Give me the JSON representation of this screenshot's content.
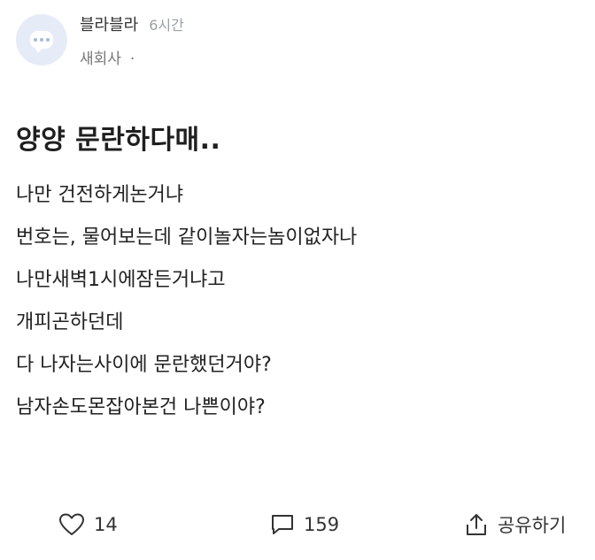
{
  "header": {
    "author": "블라블라",
    "time": "6시간",
    "company": "새회사",
    "separator": "·"
  },
  "post": {
    "title": "양양 문란하다매..",
    "lines": [
      "나만 건전하게논거냐",
      "번호는, 물어보는데 같이놀자는놈이없자나",
      "나만새벽1시에잠든거냐고",
      "개피곤하던데",
      "다 나자는사이에 문란했던거야?",
      "남자손도몬잡아본건 나쁜이야?"
    ]
  },
  "actions": {
    "likes": "14",
    "comments": "159",
    "share": "공유하기"
  },
  "icons": {
    "avatar": "chat-bubble-icon",
    "like": "heart-icon",
    "comment": "comment-icon",
    "share": "share-icon"
  },
  "colors": {
    "avatar_bg": "#e6ecf7",
    "text": "#222222",
    "muted": "#9aa0a6"
  }
}
